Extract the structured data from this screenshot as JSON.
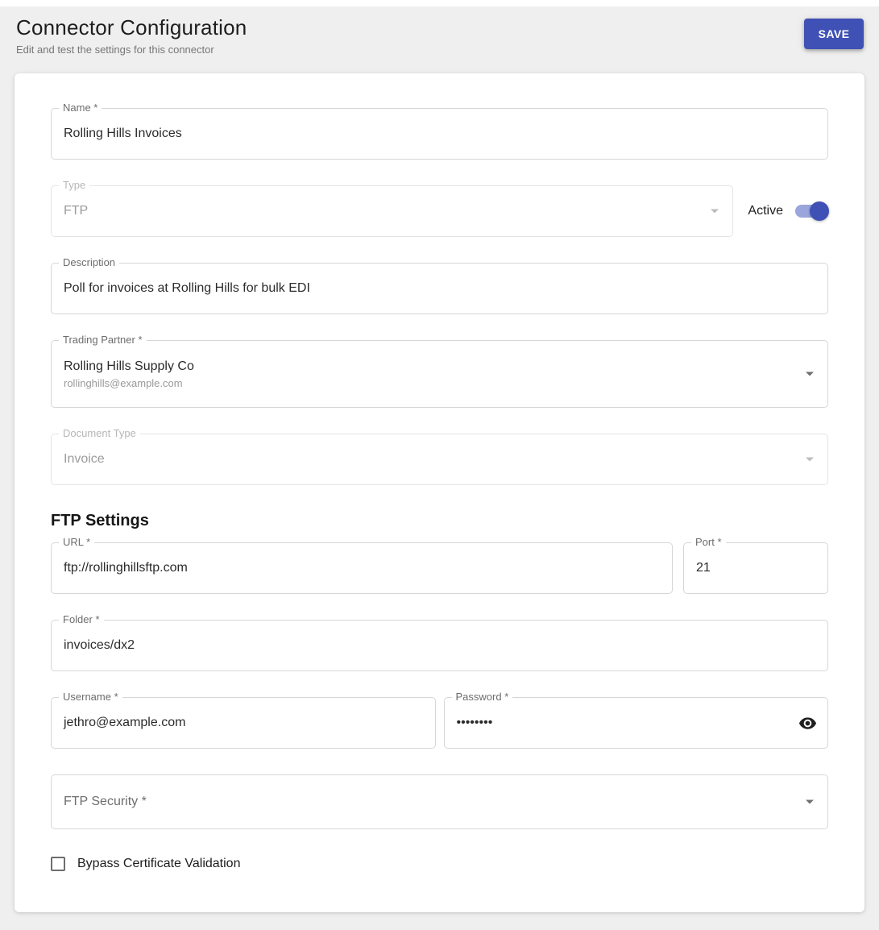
{
  "header": {
    "title": "Connector Configuration",
    "subtitle": "Edit and test the settings for this connector",
    "save_label": "SAVE"
  },
  "form": {
    "name": {
      "label": "Name *",
      "value": "Rolling Hills Invoices"
    },
    "type": {
      "label": "Type",
      "value": "FTP",
      "disabled": true
    },
    "active": {
      "label": "Active",
      "state": "on"
    },
    "description": {
      "label": "Description",
      "value": "Poll for invoices at Rolling Hills for bulk EDI"
    },
    "trading_partner": {
      "label": "Trading Partner *",
      "value": "Rolling Hills Supply Co",
      "email": "rollinghills@example.com"
    },
    "document_type": {
      "label": "Document Type",
      "value": "Invoice",
      "disabled": true
    }
  },
  "ftp": {
    "section_title": "FTP Settings",
    "url": {
      "label": "URL *",
      "value": "ftp://rollinghillsftp.com"
    },
    "port": {
      "label": "Port *",
      "value": "21"
    },
    "folder": {
      "label": "Folder *",
      "value": "invoices/dx2"
    },
    "username": {
      "label": "Username *",
      "value": "jethro@example.com"
    },
    "password": {
      "label": "Password *",
      "value": "••••••••"
    },
    "security": {
      "label": "FTP Security *"
    },
    "bypass": {
      "label": "Bypass Certificate Validation",
      "checked": false
    }
  },
  "colors": {
    "accent": "#3f51b5",
    "toggle_track": "#9aa5dc"
  }
}
